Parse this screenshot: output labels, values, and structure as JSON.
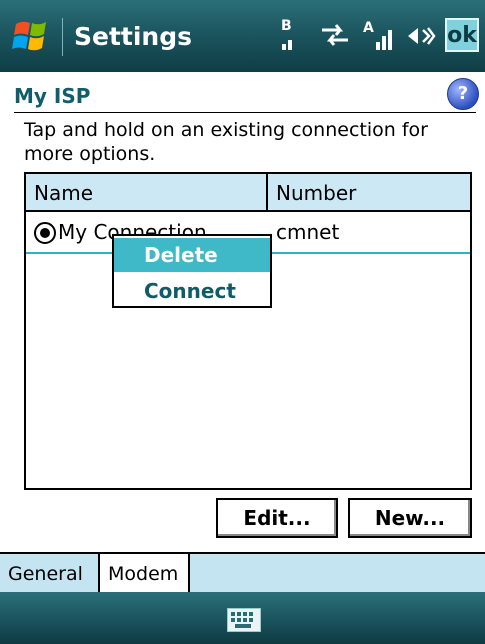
{
  "title_bar": {
    "app_title": "Settings",
    "ok_label": "ok"
  },
  "page": {
    "title": "My ISP",
    "help_label": "?"
  },
  "instructions": "Tap and hold on an existing connection for more options.",
  "list": {
    "columns": [
      "Name",
      "Number"
    ],
    "rows": [
      {
        "name": "My Connection",
        "number": "cmnet",
        "selected": true
      }
    ]
  },
  "context_menu": {
    "items": [
      "Delete",
      "Connect"
    ],
    "highlighted": "Delete"
  },
  "buttons": {
    "edit": "Edit...",
    "new": "New..."
  },
  "tabs": [
    {
      "label": "General",
      "active": false
    },
    {
      "label": "Modem",
      "active": true
    }
  ],
  "colors": {
    "accent": "#3fb8c8",
    "title_text": "#115d6b",
    "header_bg": "#cde8f5"
  }
}
